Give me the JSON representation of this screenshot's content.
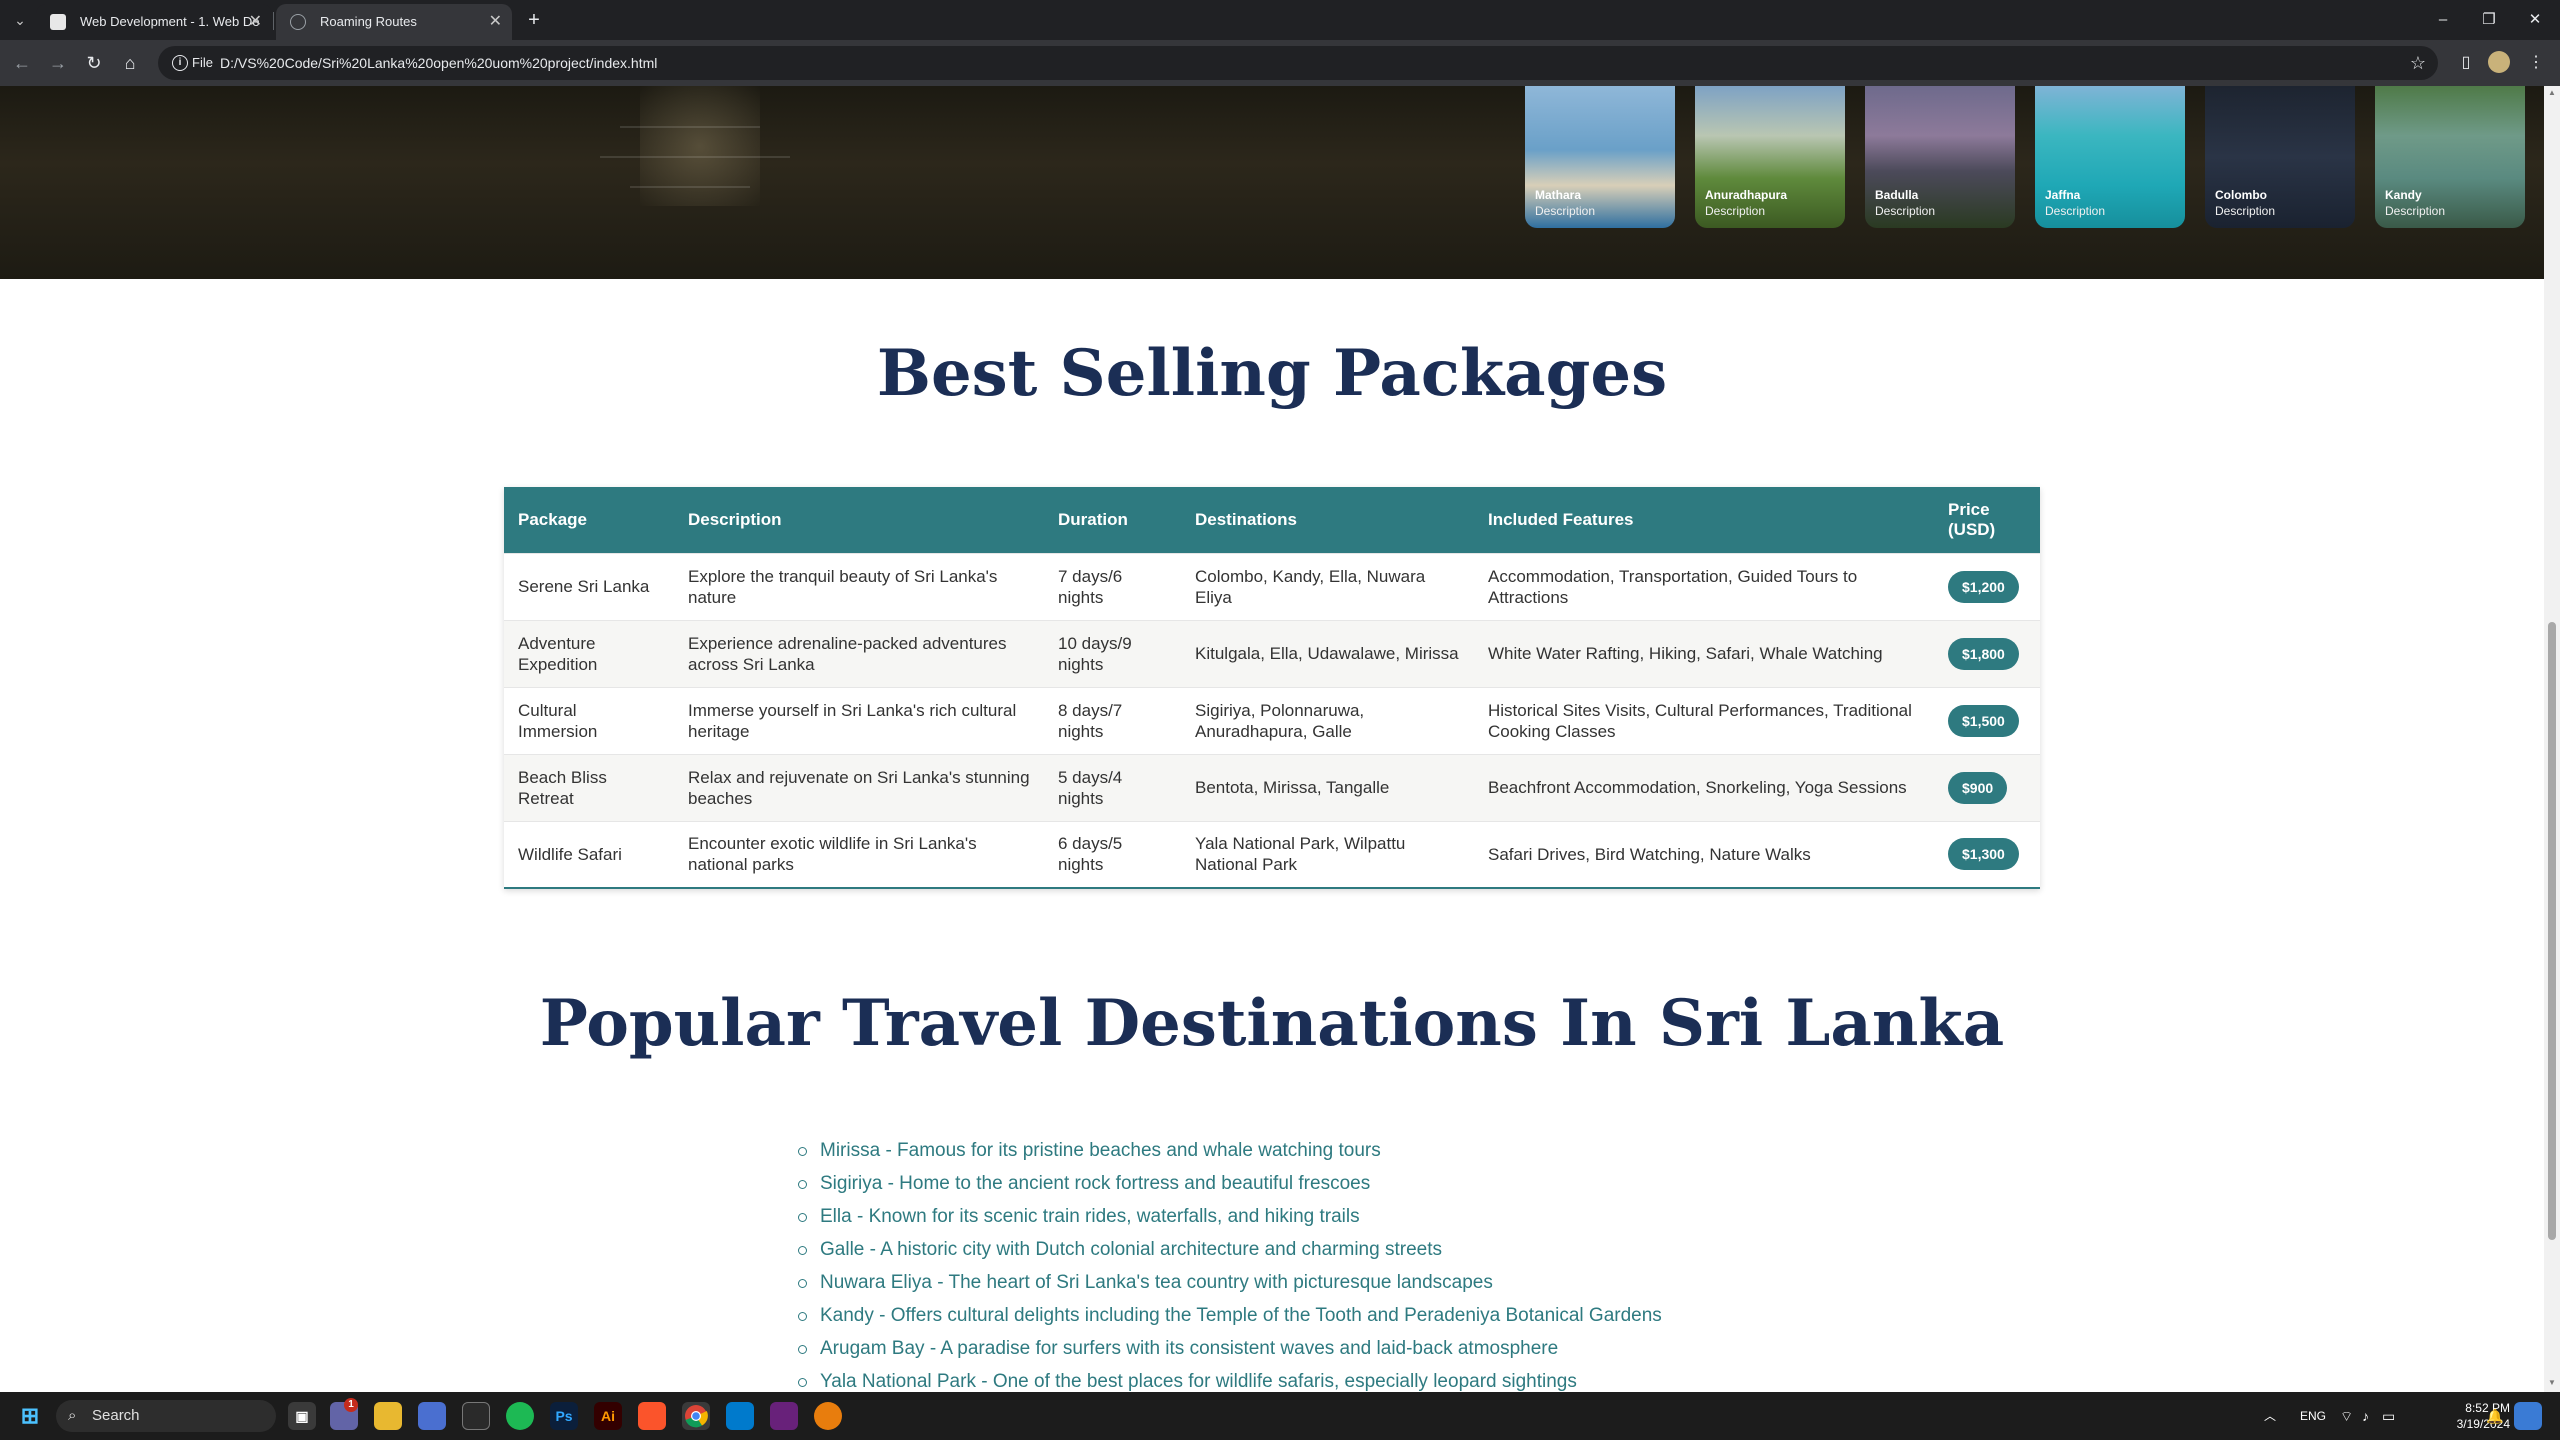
{
  "browser": {
    "tabs": [
      {
        "label": "Web Development - 1. Web De",
        "active": false
      },
      {
        "label": "Roaming Routes",
        "active": true
      }
    ],
    "new_tab_label": "+",
    "chip_label": "File",
    "url": "D:/VS%20Code/Sri%20Lanka%20open%20uom%20project/index.html"
  },
  "hero_cards": [
    {
      "name": "Mathara",
      "desc": "Description"
    },
    {
      "name": "Anuradhapura",
      "desc": "Description"
    },
    {
      "name": "Badulla",
      "desc": "Description"
    },
    {
      "name": "Jaffna",
      "desc": "Description"
    },
    {
      "name": "Colombo",
      "desc": "Description"
    },
    {
      "name": "Kandy",
      "desc": "Description"
    }
  ],
  "packages": {
    "title": "Best Selling Packages",
    "headers": [
      "Package",
      "Description",
      "Duration",
      "Destinations",
      "Included Features",
      "Price (USD)"
    ],
    "rows": [
      {
        "package": "Serene Sri Lanka",
        "description": "Explore the tranquil beauty of Sri Lanka's nature",
        "duration": "7 days/6 nights",
        "destinations": "Colombo, Kandy, Ella, Nuwara Eliya",
        "features": "Accommodation, Transportation, Guided Tours to Attractions",
        "price": "$1,200"
      },
      {
        "package": "Adventure Expedition",
        "description": "Experience adrenaline-packed adventures across Sri Lanka",
        "duration": "10 days/9 nights",
        "destinations": "Kitulgala, Ella, Udawalawe, Mirissa",
        "features": "White Water Rafting, Hiking, Safari, Whale Watching",
        "price": "$1,800"
      },
      {
        "package": "Cultural Immersion",
        "description": "Immerse yourself in Sri Lanka's rich cultural heritage",
        "duration": "8 days/7 nights",
        "destinations": "Sigiriya, Polonnaruwa, Anuradhapura, Galle",
        "features": "Historical Sites Visits, Cultural Performances, Traditional Cooking Classes",
        "price": "$1,500"
      },
      {
        "package": "Beach Bliss Retreat",
        "description": "Relax and rejuvenate on Sri Lanka's stunning beaches",
        "duration": "5 days/4 nights",
        "destinations": "Bentota, Mirissa, Tangalle",
        "features": "Beachfront Accommodation, Snorkeling, Yoga Sessions",
        "price": "$900"
      },
      {
        "package": "Wildlife Safari",
        "description": "Encounter exotic wildlife in Sri Lanka's national parks",
        "duration": "6 days/5 nights",
        "destinations": "Yala National Park, Wilpattu National Park",
        "features": "Safari Drives, Bird Watching, Nature Walks",
        "price": "$1,300"
      }
    ]
  },
  "destinations": {
    "title": "Popular Travel Destinations In Sri Lanka",
    "items": [
      "Mirissa - Famous for its pristine beaches and whale watching tours",
      "Sigiriya - Home to the ancient rock fortress and beautiful frescoes",
      "Ella - Known for its scenic train rides, waterfalls, and hiking trails",
      "Galle - A historic city with Dutch colonial architecture and charming streets",
      "Nuwara Eliya - The heart of Sri Lanka's tea country with picturesque landscapes",
      "Kandy - Offers cultural delights including the Temple of the Tooth and Peradeniya Botanical Gardens",
      "Arugam Bay - A paradise for surfers with its consistent waves and laid-back atmosphere",
      "Yala National Park - One of the best places for wildlife safaris, especially leopard sightings"
    ]
  },
  "taskbar": {
    "search_label": "Search",
    "language": "ENG",
    "time": "8:52 PM",
    "date": "3/19/2024",
    "badge": "1"
  },
  "colors": {
    "accent": "#2e7a80",
    "heading": "#1b2e55"
  }
}
